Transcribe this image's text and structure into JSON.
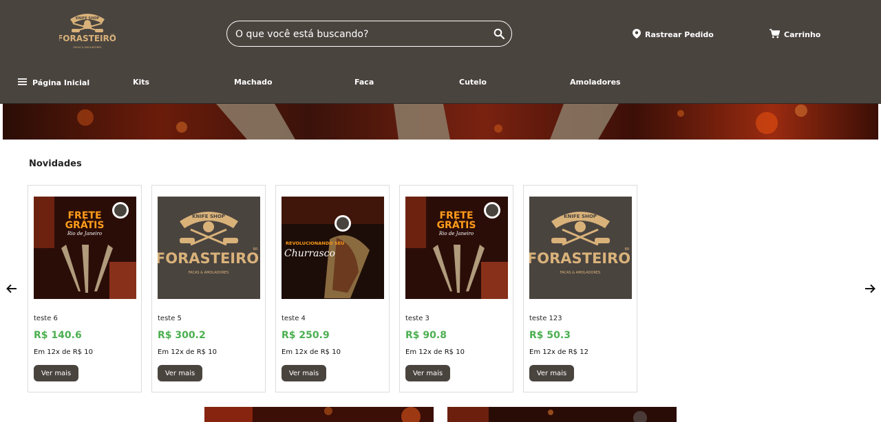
{
  "brand": {
    "name": "FORASTEIRO",
    "superscript": "BR",
    "tagline": "FACAS & AMOLADORES",
    "top": "KNIFE SHOP"
  },
  "search": {
    "placeholder": "O que você está buscando?"
  },
  "header_links": {
    "track": "Rastrear Pedido",
    "cart": "Carrinho"
  },
  "nav": {
    "home": "Página Inicial",
    "items": [
      "Kits",
      "Machado",
      "Faca",
      "Cutelo",
      "Amoladores"
    ]
  },
  "section": {
    "title": "Novidades"
  },
  "products": [
    {
      "name": "teste 6",
      "price": "R$ 140.6",
      "installments": "Em 12x de R$ 10",
      "button": "Ver mais",
      "image": "frete-gratis",
      "image_text": [
        "FRETE",
        "GRÁTIS",
        "Rio de Janeiro"
      ]
    },
    {
      "name": "teste 5",
      "price": "R$ 300.2",
      "installments": "Em 12x de R$ 10",
      "button": "Ver mais",
      "image": "logo"
    },
    {
      "name": "teste 4",
      "price": "R$ 250.9",
      "installments": "Em 12x de R$ 10",
      "button": "Ver mais",
      "image": "churrasco",
      "image_text": [
        "REVOLUCIONANDO SEU",
        "Churrasco"
      ]
    },
    {
      "name": "teste 3",
      "price": "R$ 90.8",
      "installments": "Em 12x de R$ 10",
      "button": "Ver mais",
      "image": "frete-gratis",
      "image_text": [
        "FRETE",
        "GRÁTIS",
        "Rio de Janeiro"
      ]
    },
    {
      "name": "teste 123",
      "price": "R$ 50.3",
      "installments": "Em 12x de R$ 12",
      "button": "Ver mais",
      "image": "logo"
    }
  ],
  "colors": {
    "header_bg": "#4a443f",
    "price": "#4caf50",
    "logo_gold": "#d9b27a",
    "button_bg": "#4a443f"
  }
}
